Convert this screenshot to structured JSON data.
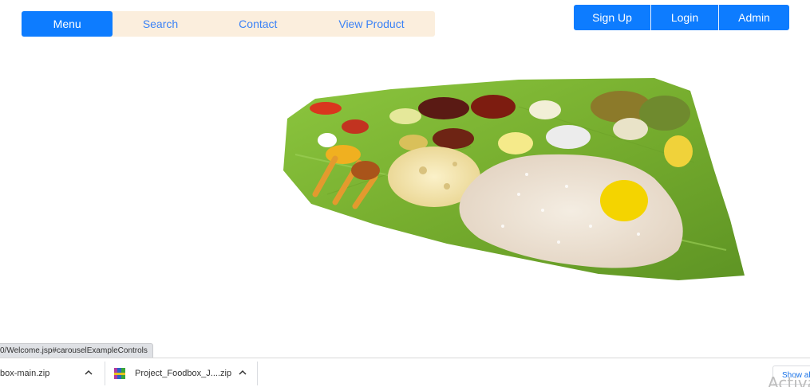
{
  "nav": {
    "menu": "Menu",
    "search": "Search",
    "contact": "Contact",
    "view_product": "View Product"
  },
  "auth": {
    "signup": "Sign Up",
    "login": "Login",
    "admin": "Admin"
  },
  "status_url": "0/Welcome.jsp#carouselExampleControls",
  "downloads": [
    {
      "name": "box-main.zip"
    },
    {
      "name": "Project_Foodbox_J....zip"
    }
  ],
  "show_all": "Show al",
  "watermark": "Activa",
  "colors": {
    "primary": "#0d7cff",
    "nav_bg": "#fbeedd",
    "leaf_green": "#7cb32a"
  },
  "icons": [
    "chevron-up-icon",
    "zip-archive-icon"
  ]
}
